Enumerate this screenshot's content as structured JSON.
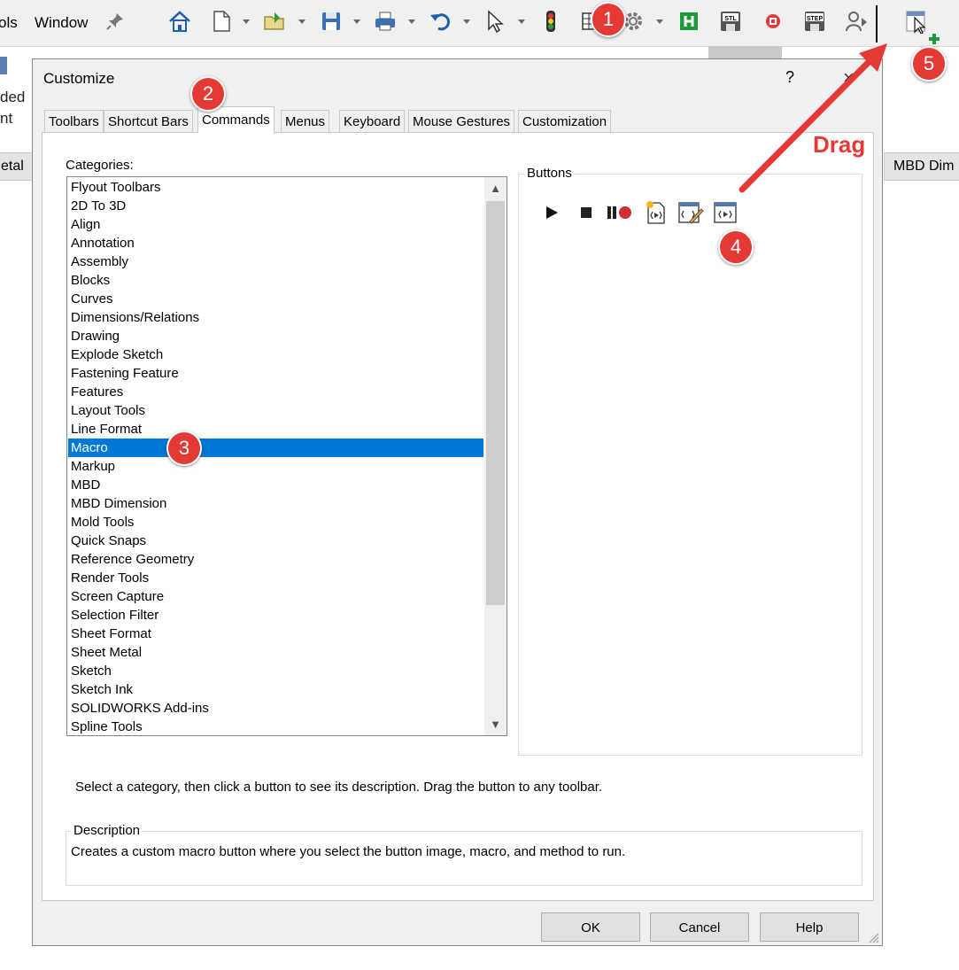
{
  "menubar": {
    "items": [
      "ols",
      "Window"
    ]
  },
  "toolbar": {
    "icons": [
      "pin-icon",
      "home-icon",
      "new-document-icon",
      "open-folder-icon",
      "save-icon",
      "print-icon",
      "undo-icon",
      "select-arrow-icon",
      "traffic-light-icon",
      "file-properties-icon",
      "gear-icon",
      "green-app-icon",
      "stl-save-icon",
      "stop-record-icon",
      "step-save-icon",
      "user-forward-icon",
      "new-macro-button-icon"
    ]
  },
  "background": {
    "left_text_1": "ded",
    "left_text_2": "nt",
    "left_tab": "etal",
    "right_tab": "MBD Dim"
  },
  "dialog": {
    "title": "Customize",
    "help_label": "?",
    "close_label": "×",
    "tabs": [
      {
        "label": "Toolbars"
      },
      {
        "label": "Shortcut Bars"
      },
      {
        "label": "Commands"
      },
      {
        "label": "Menus"
      },
      {
        "label": "Keyboard"
      },
      {
        "label": "Mouse Gestures"
      },
      {
        "label": "Customization"
      }
    ],
    "active_tab": "Commands",
    "categories_label": "Categories:",
    "categories": [
      "Flyout Toolbars",
      "2D To 3D",
      "Align",
      "Annotation",
      "Assembly",
      "Blocks",
      "Curves",
      "Dimensions/Relations",
      "Drawing",
      "Explode Sketch",
      "Fastening Feature",
      "Features",
      "Layout Tools",
      "Line Format",
      "Macro",
      "Markup",
      "MBD",
      "MBD Dimension",
      "Mold Tools",
      "Quick Snaps",
      "Reference Geometry",
      "Render Tools",
      "Screen Capture",
      "Selection Filter",
      "Sheet Format",
      "Sheet Metal",
      "Sketch",
      "Sketch Ink",
      "SOLIDWORKS Add-ins",
      "Spline Tools"
    ],
    "selected_category": "Macro",
    "buttons_label": "Buttons",
    "buttons": [
      "play-macro-icon",
      "stop-macro-icon",
      "pause-record-icon",
      "new-macro-icon",
      "edit-macro-icon",
      "new-macro-button-icon"
    ],
    "hint": "Select a category, then click a button to see its description. Drag the button to any toolbar.",
    "description_label": "Description",
    "description_text": "Creates a custom macro button where you select the button image, macro, and method to run.",
    "ok_label": "OK",
    "cancel_label": "Cancel",
    "help_button_label": "Help"
  },
  "annotations": {
    "drag_label": "Drag",
    "badges": [
      "1",
      "2",
      "3",
      "4",
      "5"
    ],
    "color": "#e53935"
  },
  "colors": {
    "selection": "#0078d7",
    "dialog_bg": "#f0f0f0",
    "panel_bg": "#ffffff"
  }
}
